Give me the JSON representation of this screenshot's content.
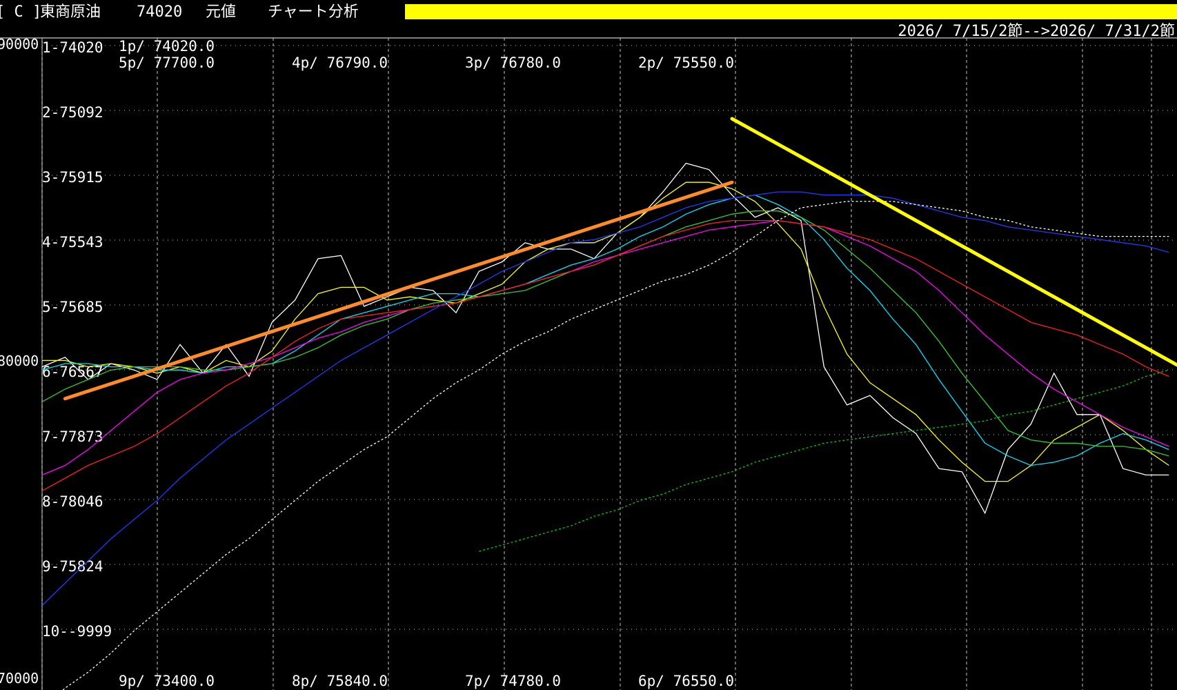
{
  "header": {
    "bracket": "[ C ]",
    "name": "東商原油",
    "code": "74020",
    "mode": "元値",
    "title": "チャート分析",
    "date_range": "2026/ 7/15/2節-->2026/ 7/31/2節",
    "highlight_color": "#ffff00"
  },
  "colors": {
    "background": "#000000",
    "text": "#ffffff",
    "grid": "#c8c8c8",
    "orange_trend": "#ff8c28",
    "yellow_trend": "#ffff00"
  },
  "chart_data": {
    "type": "line",
    "y_axis_labels": [
      "90000",
      "80000",
      "70000"
    ],
    "ylim": [
      70000,
      90000
    ],
    "row_labels": [
      "1-74020",
      "2-75092",
      "3-75915",
      "4-75543",
      "5-75685",
      "6-76567",
      "7-77873",
      "8-78046",
      "9-75824",
      "10--9999"
    ],
    "price_labels_top": [
      "1p/ 74020.0",
      "5p/ 77700.0",
      "4p/ 76790.0",
      "3p/ 76780.0",
      "2p/ 75550.0"
    ],
    "price_labels_bottom": [
      "9p/ 73400.0",
      "8p/ 75840.0",
      "7p/ 74780.0",
      "6p/ 76550.0"
    ],
    "x_count": 50,
    "series": [
      {
        "key": "price",
        "color": "#ffffff",
        "dash": false,
        "values": [
          79900,
          80200,
          79500,
          80000,
          79800,
          79500,
          80600,
          79700,
          80600,
          79600,
          81300,
          82000,
          83300,
          83400,
          81800,
          82100,
          82400,
          82300,
          81600,
          82900,
          83200,
          83800,
          83600,
          83600,
          83300,
          84100,
          84600,
          85400,
          86300,
          86100,
          85300,
          84600,
          84900,
          84500,
          79900,
          78700,
          79000,
          78300,
          77800,
          76700,
          76600,
          75300,
          77300,
          78100,
          79700,
          78400,
          78400,
          76700,
          76500,
          76500
        ]
      },
      {
        "key": "ma5",
        "color": "#ffff00",
        "dash": false,
        "values": [
          80100,
          80100,
          79900,
          80000,
          79900,
          79700,
          79900,
          79700,
          80100,
          79900,
          80400,
          81400,
          82200,
          82400,
          82400,
          82000,
          82100,
          82000,
          81900,
          82200,
          82500,
          83200,
          83600,
          83800,
          83800,
          84100,
          84600,
          85200,
          85700,
          85700,
          85500,
          85100,
          84400,
          83600,
          81800,
          80300,
          79400,
          78900,
          78400,
          77600,
          76900,
          76300,
          76300,
          76800,
          77600,
          78000,
          78400,
          77900,
          77300,
          76800
        ]
      },
      {
        "key": "ma10",
        "color": "#00e5ff",
        "dash": false,
        "values": [
          79800,
          80000,
          80000,
          79900,
          79900,
          79800,
          79800,
          79700,
          79900,
          79900,
          80000,
          80400,
          80900,
          81400,
          81600,
          81800,
          82000,
          82200,
          82200,
          82100,
          82300,
          82500,
          82800,
          83100,
          83300,
          83600,
          84000,
          84300,
          84700,
          85000,
          85200,
          85300,
          85000,
          84600,
          83900,
          83000,
          82300,
          81400,
          80600,
          79500,
          78500,
          77500,
          77100,
          76800,
          76900,
          77100,
          77500,
          77800,
          77600,
          77300
        ]
      },
      {
        "key": "ma15",
        "color": "#32cd32",
        "dash": false,
        "values": [
          78800,
          79200,
          79500,
          79800,
          79900,
          79900,
          79900,
          79800,
          79800,
          79900,
          80000,
          80200,
          80500,
          80900,
          81200,
          81400,
          81700,
          81900,
          82000,
          82100,
          82200,
          82300,
          82600,
          82900,
          83100,
          83400,
          83700,
          84000,
          84300,
          84500,
          84700,
          84800,
          84800,
          84600,
          84200,
          83600,
          83000,
          82300,
          81600,
          80700,
          79700,
          78800,
          77900,
          77600,
          77500,
          77500,
          77400,
          77400,
          77300,
          77100
        ]
      },
      {
        "key": "ma20",
        "color": "#ff00ff",
        "dash": false,
        "values": [
          76500,
          76800,
          77300,
          77900,
          78500,
          79100,
          79500,
          79700,
          79800,
          80000,
          80200,
          80500,
          80800,
          81000,
          81300,
          81500,
          81700,
          81800,
          81900,
          82100,
          82300,
          82500,
          82700,
          82900,
          83200,
          83400,
          83600,
          83800,
          84000,
          84200,
          84300,
          84400,
          84500,
          84400,
          84300,
          84000,
          83700,
          83300,
          82900,
          82300,
          81600,
          80900,
          80300,
          79700,
          79200,
          78800,
          78400,
          78000,
          77700,
          77400
        ]
      },
      {
        "key": "ma25",
        "color": "#ff1e1e",
        "dash": false,
        "values": [
          76000,
          76400,
          76800,
          77100,
          77400,
          77800,
          78300,
          78800,
          79300,
          79700,
          80200,
          80700,
          81100,
          81400,
          81500,
          81600,
          81700,
          81800,
          81900,
          82100,
          82300,
          82500,
          82700,
          82900,
          83100,
          83400,
          83700,
          84000,
          84200,
          84400,
          84500,
          84500,
          84500,
          84400,
          84300,
          84100,
          83900,
          83600,
          83300,
          82900,
          82500,
          82100,
          81700,
          81300,
          81100,
          80900,
          80600,
          80300,
          79900,
          79600
        ]
      },
      {
        "key": "ma40",
        "color": "#1e3cff",
        "dash": false,
        "values": [
          72400,
          73100,
          73800,
          74500,
          75100,
          75700,
          76400,
          77000,
          77600,
          78100,
          78600,
          79100,
          79600,
          80100,
          80500,
          80900,
          81300,
          81700,
          82100,
          82500,
          82900,
          83200,
          83500,
          83800,
          83900,
          84100,
          84300,
          84600,
          84900,
          85100,
          85200,
          85300,
          85400,
          85400,
          85300,
          85300,
          85300,
          85200,
          85000,
          84800,
          84600,
          84500,
          84300,
          84200,
          84100,
          84000,
          83900,
          83800,
          83700,
          83500
        ]
      },
      {
        "key": "ma75",
        "color": "#ffffff",
        "dash": true,
        "values": [
          69100,
          69800,
          70300,
          70900,
          71600,
          72200,
          72800,
          73400,
          74000,
          74500,
          75100,
          75700,
          76300,
          76800,
          77300,
          77700,
          78300,
          78900,
          79400,
          79800,
          80300,
          80700,
          81000,
          81400,
          81700,
          82000,
          82300,
          82600,
          82800,
          83100,
          83500,
          84000,
          84500,
          84900,
          85000,
          85100,
          85100,
          85100,
          85000,
          84900,
          84800,
          84600,
          84500,
          84300,
          84200,
          84100,
          84000,
          84000,
          84000,
          84000
        ]
      },
      {
        "key": "ma200",
        "color": "#00cc00",
        "dash": true,
        "start_index": 19,
        "values": [
          null,
          null,
          null,
          null,
          null,
          null,
          null,
          null,
          null,
          null,
          null,
          null,
          null,
          null,
          null,
          null,
          null,
          null,
          null,
          74100,
          74300,
          74500,
          74700,
          74900,
          75200,
          75400,
          75700,
          75900,
          76200,
          76400,
          76600,
          76900,
          77100,
          77300,
          77500,
          77600,
          77700,
          77800,
          77900,
          78000,
          78100,
          78200,
          78400,
          78500,
          78700,
          78900,
          79100,
          79300,
          79600,
          79800
        ]
      }
    ],
    "trendlines": [
      {
        "key": "orange-uptrend",
        "color": "#ff8c28",
        "from": {
          "i": 1,
          "v": 78900
        },
        "to": {
          "i": 30,
          "v": 85700
        }
      },
      {
        "key": "yellow-downtrend",
        "color": "#ffff00",
        "from": {
          "i": 30,
          "v": 87700
        },
        "to": {
          "i": 50,
          "v": 79700
        }
      }
    ]
  }
}
